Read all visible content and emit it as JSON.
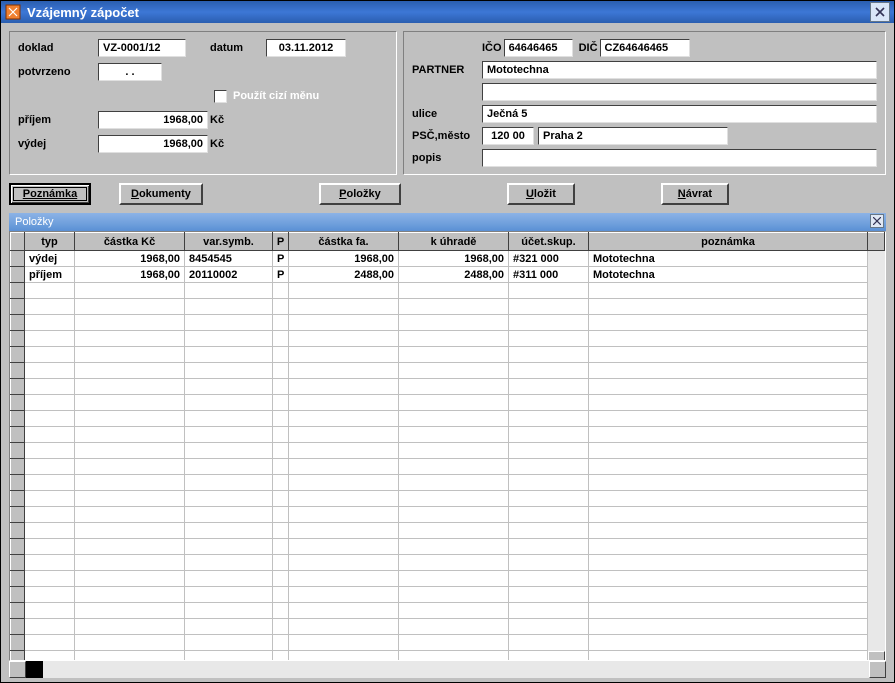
{
  "window": {
    "title": "Vzájemný zápočet"
  },
  "left": {
    "doklad_label": "doklad",
    "doklad_value": "VZ-0001/12",
    "datum_label": "datum",
    "datum_value": "03.11.2012",
    "potvrzeno_label": "potvrzeno",
    "potvrzeno_value": "  .  .    ",
    "cizi_mena_label": "Použít cizí měnu",
    "prijem_label": "příjem",
    "prijem_value": "1968,00",
    "vydej_label": "výdej",
    "vydej_value": "1968,00",
    "kc_suffix": "Kč"
  },
  "right": {
    "ico_label": "IČO",
    "ico_value": "64646465",
    "dic_label": "DIČ",
    "dic_value": "CZ64646465",
    "partner_label": "PARTNER",
    "partner_value": "Mototechna",
    "partner2_value": "",
    "ulice_label": "ulice",
    "ulice_value": "Ječná 5",
    "pscmesto_label": "PSČ,město",
    "psc_value": "120 00",
    "mesto_value": "Praha 2",
    "popis_label": "popis",
    "popis_value": ""
  },
  "buttons": {
    "poznamka": "Poznámka",
    "dokumenty": "Dokumenty",
    "polozky": "Položky",
    "ulozit": "Uložit",
    "navrat": "Návrat"
  },
  "grid": {
    "title": "Položky",
    "headers": {
      "typ": "typ",
      "castka_kc": "částka Kč",
      "var_symb": "var.symb.",
      "p": "P",
      "castka_fa": "částka fa.",
      "k_uhrade": "k úhradě",
      "ucet_skup": "účet.skup.",
      "poznamka": "poznámka"
    },
    "rows": [
      {
        "typ": "výdej",
        "castka_kc": "1968,00",
        "var_symb": "8454545",
        "p": "P",
        "castka_fa": "1968,00",
        "k_uhrade": "1968,00",
        "ucet_skup": "#321 000",
        "poznamka": "Mototechna"
      },
      {
        "typ": "příjem",
        "castka_kc": "1968,00",
        "var_symb": "20110002",
        "p": "P",
        "castka_fa": "2488,00",
        "k_uhrade": "2488,00",
        "ucet_skup": "#311 000",
        "poznamka": "Mototechna"
      }
    ]
  }
}
